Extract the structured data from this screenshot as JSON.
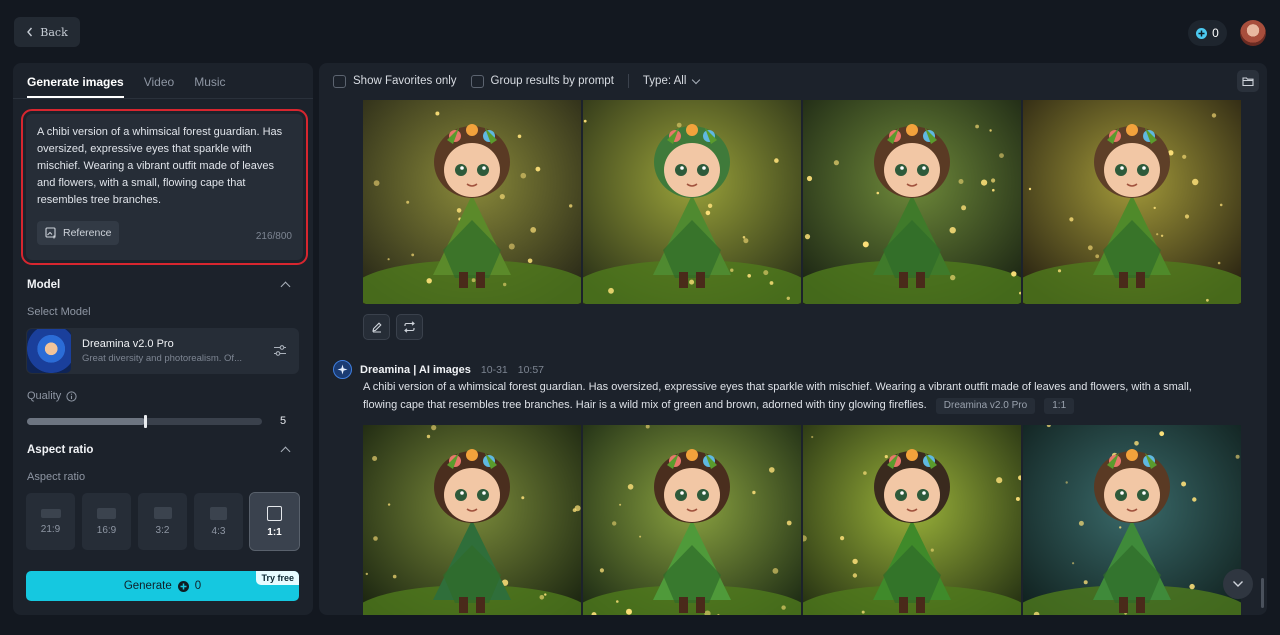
{
  "header": {
    "back_label": "Back",
    "credits": "0"
  },
  "left_panel": {
    "tabs": [
      {
        "label": "Generate images",
        "active": true
      },
      {
        "label": "Video",
        "active": false
      },
      {
        "label": "Music",
        "active": false
      }
    ],
    "prompt": {
      "text": "A chibi version of a whimsical forest guardian. Has oversized, expressive eyes that sparkle with mischief. Wearing a vibrant outfit made of leaves and flowers, with a small, flowing cape that resembles tree branches.",
      "reference_label": "Reference",
      "counter": "216/800"
    },
    "model": {
      "section_title": "Model",
      "select_label": "Select Model",
      "name": "Dreamina v2.0 Pro",
      "description": "Great diversity and photorealism. Of..."
    },
    "quality": {
      "label": "Quality",
      "value": "5",
      "level": 0.5
    },
    "aspect": {
      "section_title": "Aspect ratio",
      "label": "Aspect ratio",
      "options": [
        "21:9",
        "16:9",
        "3:2",
        "4:3",
        "1:1"
      ],
      "selected": "1:1"
    },
    "generate": {
      "label": "Generate",
      "cost": "0",
      "badge": "Try free"
    }
  },
  "main": {
    "toolbar": {
      "favorites_label": "Show Favorites only",
      "group_label": "Group results by prompt",
      "type_label": "Type: All"
    },
    "result": {
      "source": "Dreamina | AI images",
      "date": "10-31",
      "time": "10:57",
      "prompt": "A chibi version of a whimsical forest guardian. Has oversized, expressive eyes that sparkle with mischief. Wearing a vibrant outfit made of leaves and flowers, with a small, flowing cape that resembles tree branches. Hair is a wild mix of green and brown, adorned with tiny glowing fireflies.",
      "model_tag": "Dreamina v2.0 Pro",
      "ratio_tag": "1:1"
    }
  },
  "colors": {
    "accent": "#15c8e0",
    "highlight_border": "#d7262f",
    "background": "#131820",
    "panel": "#1c222b"
  }
}
